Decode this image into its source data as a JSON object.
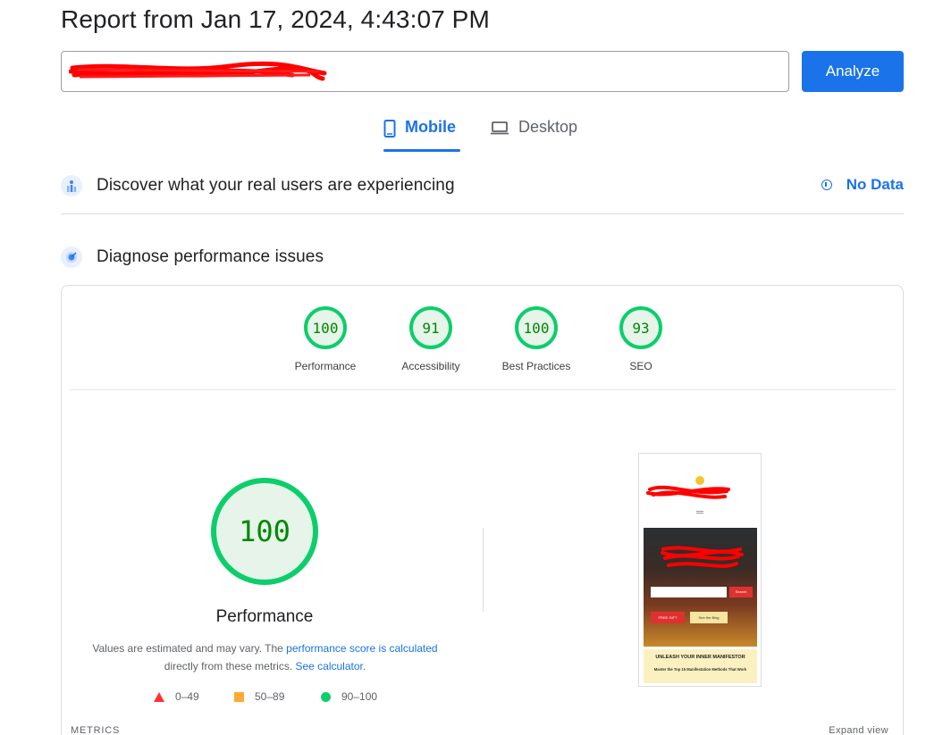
{
  "report": {
    "title": "Report from Jan 17, 2024, 4:43:07 PM"
  },
  "url_bar": {
    "value": "",
    "analyze_label": "Analyze"
  },
  "tabs": [
    {
      "label": "Mobile",
      "selected": true
    },
    {
      "label": "Desktop",
      "selected": false
    }
  ],
  "field_data": {
    "title": "Discover what your real users are experiencing",
    "status": "No Data"
  },
  "lab_data": {
    "title": "Diagnose performance issues",
    "categories": [
      {
        "score": "100",
        "label": "Performance"
      },
      {
        "score": "91",
        "label": "Accessibility"
      },
      {
        "score": "100",
        "label": "Best Practices"
      },
      {
        "score": "93",
        "label": "SEO"
      }
    ],
    "performance": {
      "score": "100",
      "title": "Performance",
      "desc_1": "Values are estimated and may vary. The ",
      "link_1": "performance score is calculated",
      "desc_2": "directly from these metrics. ",
      "link_2": "See calculator."
    },
    "legend": [
      {
        "range": "0–49",
        "color": "#ff3333"
      },
      {
        "range": "50–89",
        "color": "#ffaa33"
      },
      {
        "range": "90–100",
        "color": "#0cce6b"
      }
    ],
    "metrics_label": "METRICS",
    "expand_label": "Expand view",
    "screenshot": {
      "search_btn": "Search",
      "cta_primary": "FREE GIFT",
      "cta_secondary": "See the Blog",
      "heading": "UNLEASH YOUR INNER MANIFESTOR",
      "subheading": "Master the Top 15 Manifestation Methods That Work"
    }
  },
  "colors": {
    "accent": "#1a73e8",
    "pass": "#0cce6b",
    "pass_text": "#008800",
    "redaction": "#ff0000"
  }
}
